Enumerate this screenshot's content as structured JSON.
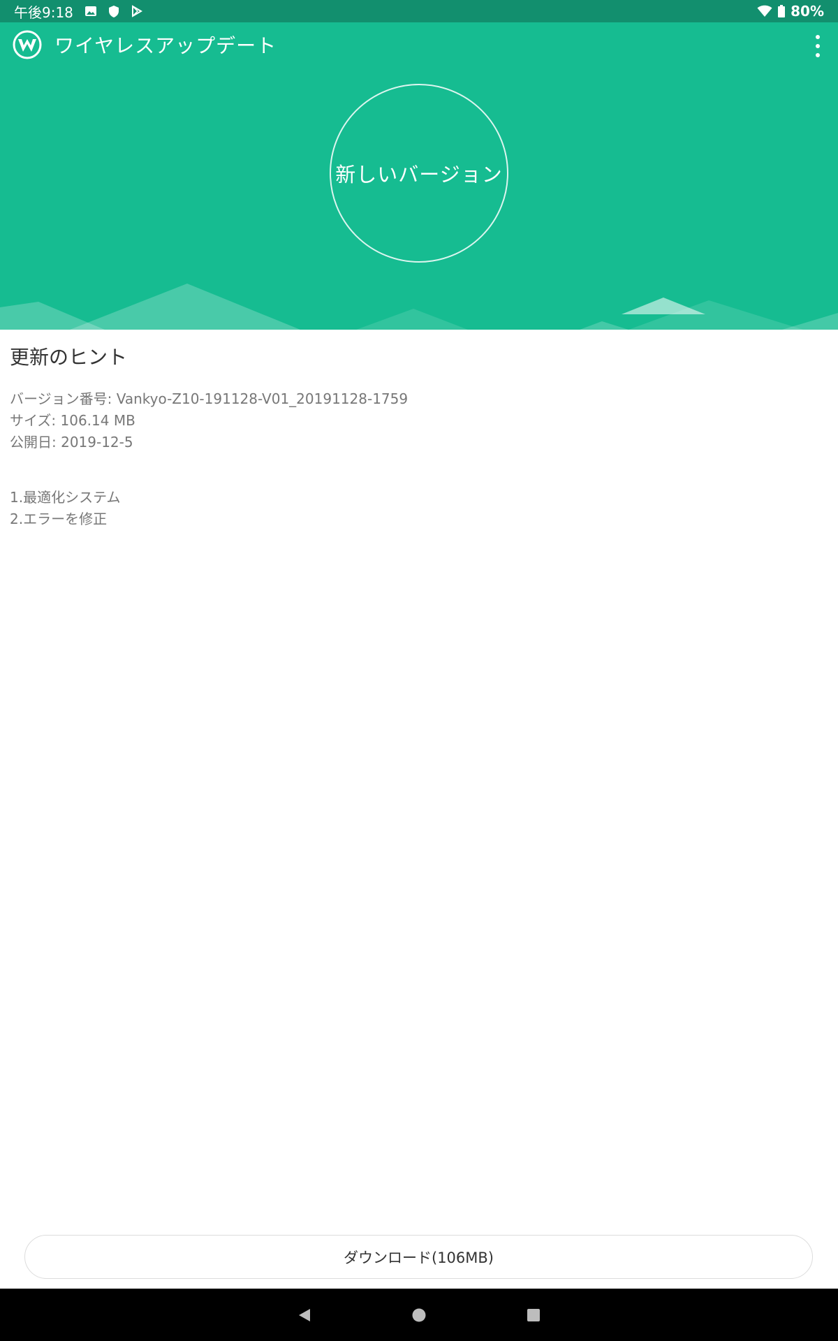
{
  "status_bar": {
    "time": "午後9:18",
    "battery": "80%",
    "icons": [
      "image-icon",
      "shield-icon",
      "play-store-icon",
      "wifi-icon",
      "battery-icon"
    ]
  },
  "app_bar": {
    "title": "ワイヤレスアップデート",
    "logo_icon": "wireless-update-logo-icon",
    "menu_icon": "more-vert-icon"
  },
  "hero": {
    "status_label": "新しいバージョン"
  },
  "update_info": {
    "section_title": "更新のヒント",
    "version": "バージョン番号: Vankyo-Z10-191128-V01_20191128-1759",
    "size": "サイズ: 106.14 MB",
    "release_date": "公開日: 2019-12-5",
    "changes": [
      "1.最適化システム",
      "2.エラーを修正"
    ]
  },
  "download_button": {
    "label": "ダウンロード(106MB)"
  },
  "nav_bar": {
    "icons": [
      "back-icon",
      "home-icon",
      "recents-icon"
    ]
  },
  "colors": {
    "header": "#16bc91",
    "status_bar": "#128f6e"
  }
}
